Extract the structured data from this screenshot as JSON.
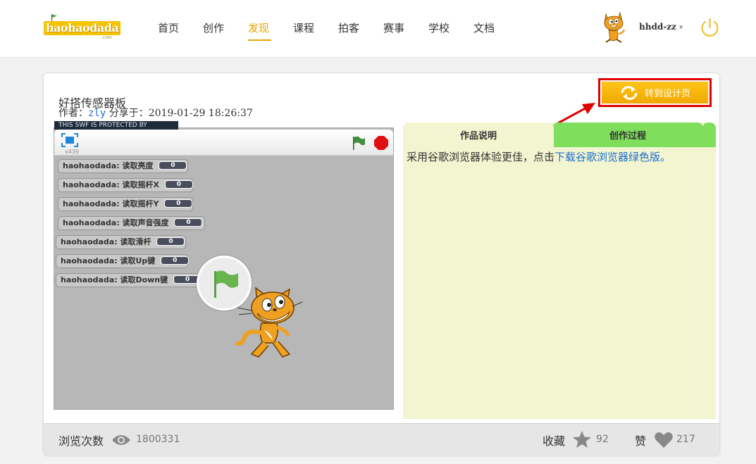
{
  "brand": {
    "name": "haohaodada",
    "suffix": ".com"
  },
  "nav": {
    "items": [
      {
        "label": "首页"
      },
      {
        "label": "创作"
      },
      {
        "label": "发现",
        "active": true
      },
      {
        "label": "课程"
      },
      {
        "label": "拍客"
      },
      {
        "label": "赛事"
      },
      {
        "label": "学校"
      },
      {
        "label": "文档"
      }
    ]
  },
  "user": {
    "name": "hhdd-zz",
    "avatar_icon": "scratch-cat-icon",
    "logout_icon": "power-icon"
  },
  "project": {
    "title": "好搭传感器板",
    "author_label": "作者：",
    "author": "zly",
    "shared_label": "分享于：",
    "shared_at": "2019-01-29 18:26:37",
    "design_button": "转到设计页"
  },
  "player": {
    "protect_strip": "THIS SWF IS PROTECTED BY",
    "version": "v439",
    "monitors": [
      {
        "label": "haohaodada: 读取亮度",
        "value": "0"
      },
      {
        "label": "haohaodada: 读取摇杆X",
        "value": "0"
      },
      {
        "label": "haohaodada: 读取摇杆Y",
        "value": "0"
      },
      {
        "label": "haohaodada: 读取声音强度",
        "value": "0"
      },
      {
        "label": "haohaodada: 读取滑杆",
        "value": "0"
      },
      {
        "label": "haohaodada: 读取Up键",
        "value": "0"
      },
      {
        "label": "haohaodada: 读取Down键",
        "value": "0"
      }
    ]
  },
  "tabs": {
    "description": "作品说明",
    "process": "创作过程",
    "desc_text": "采用谷歌浏览器体验更佳，点击",
    "desc_link": "下载谷歌浏览器绿色版。"
  },
  "stats": {
    "views_label": "浏览次数",
    "views": "1800331",
    "favorites_label": "收藏",
    "favorites": "92",
    "likes_label": "赞",
    "likes": "217"
  },
  "colors": {
    "accent": "#e8a400",
    "link": "#1f6fd0",
    "tab_green": "#7fde5c",
    "panel_bg": "#f2f5cf",
    "highlight_red": "#e10000"
  }
}
